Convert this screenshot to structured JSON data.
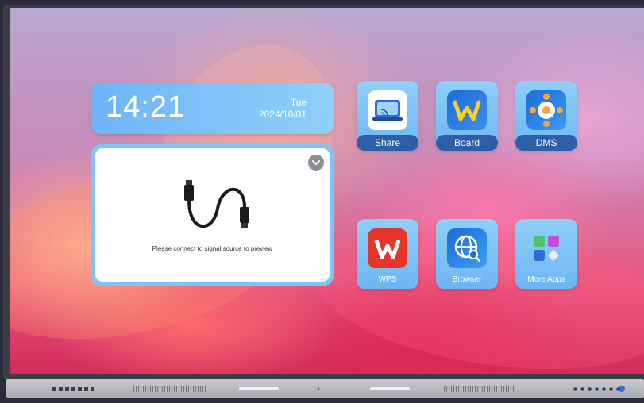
{
  "clock": {
    "time": "14:21",
    "day": "Tue",
    "date": "2024/10/01"
  },
  "preview": {
    "message": "Please connect to signal source to preview"
  },
  "apps": [
    {
      "label": "Share",
      "icon": "screen-cast-icon"
    },
    {
      "label": "Board",
      "icon": "whiteboard-w-icon"
    },
    {
      "label": "DMS",
      "icon": "device-management-icon"
    },
    {
      "label": "WPS",
      "icon": "wps-office-icon"
    },
    {
      "label": "Browser",
      "icon": "globe-search-icon"
    },
    {
      "label": "More Apps",
      "icon": "app-grid-icon"
    }
  ],
  "colors": {
    "tile": "#7cc6f6",
    "label_bar": "#2f5ea8",
    "wps_red": "#e8352b",
    "board_blue": "#1e6bd6"
  }
}
